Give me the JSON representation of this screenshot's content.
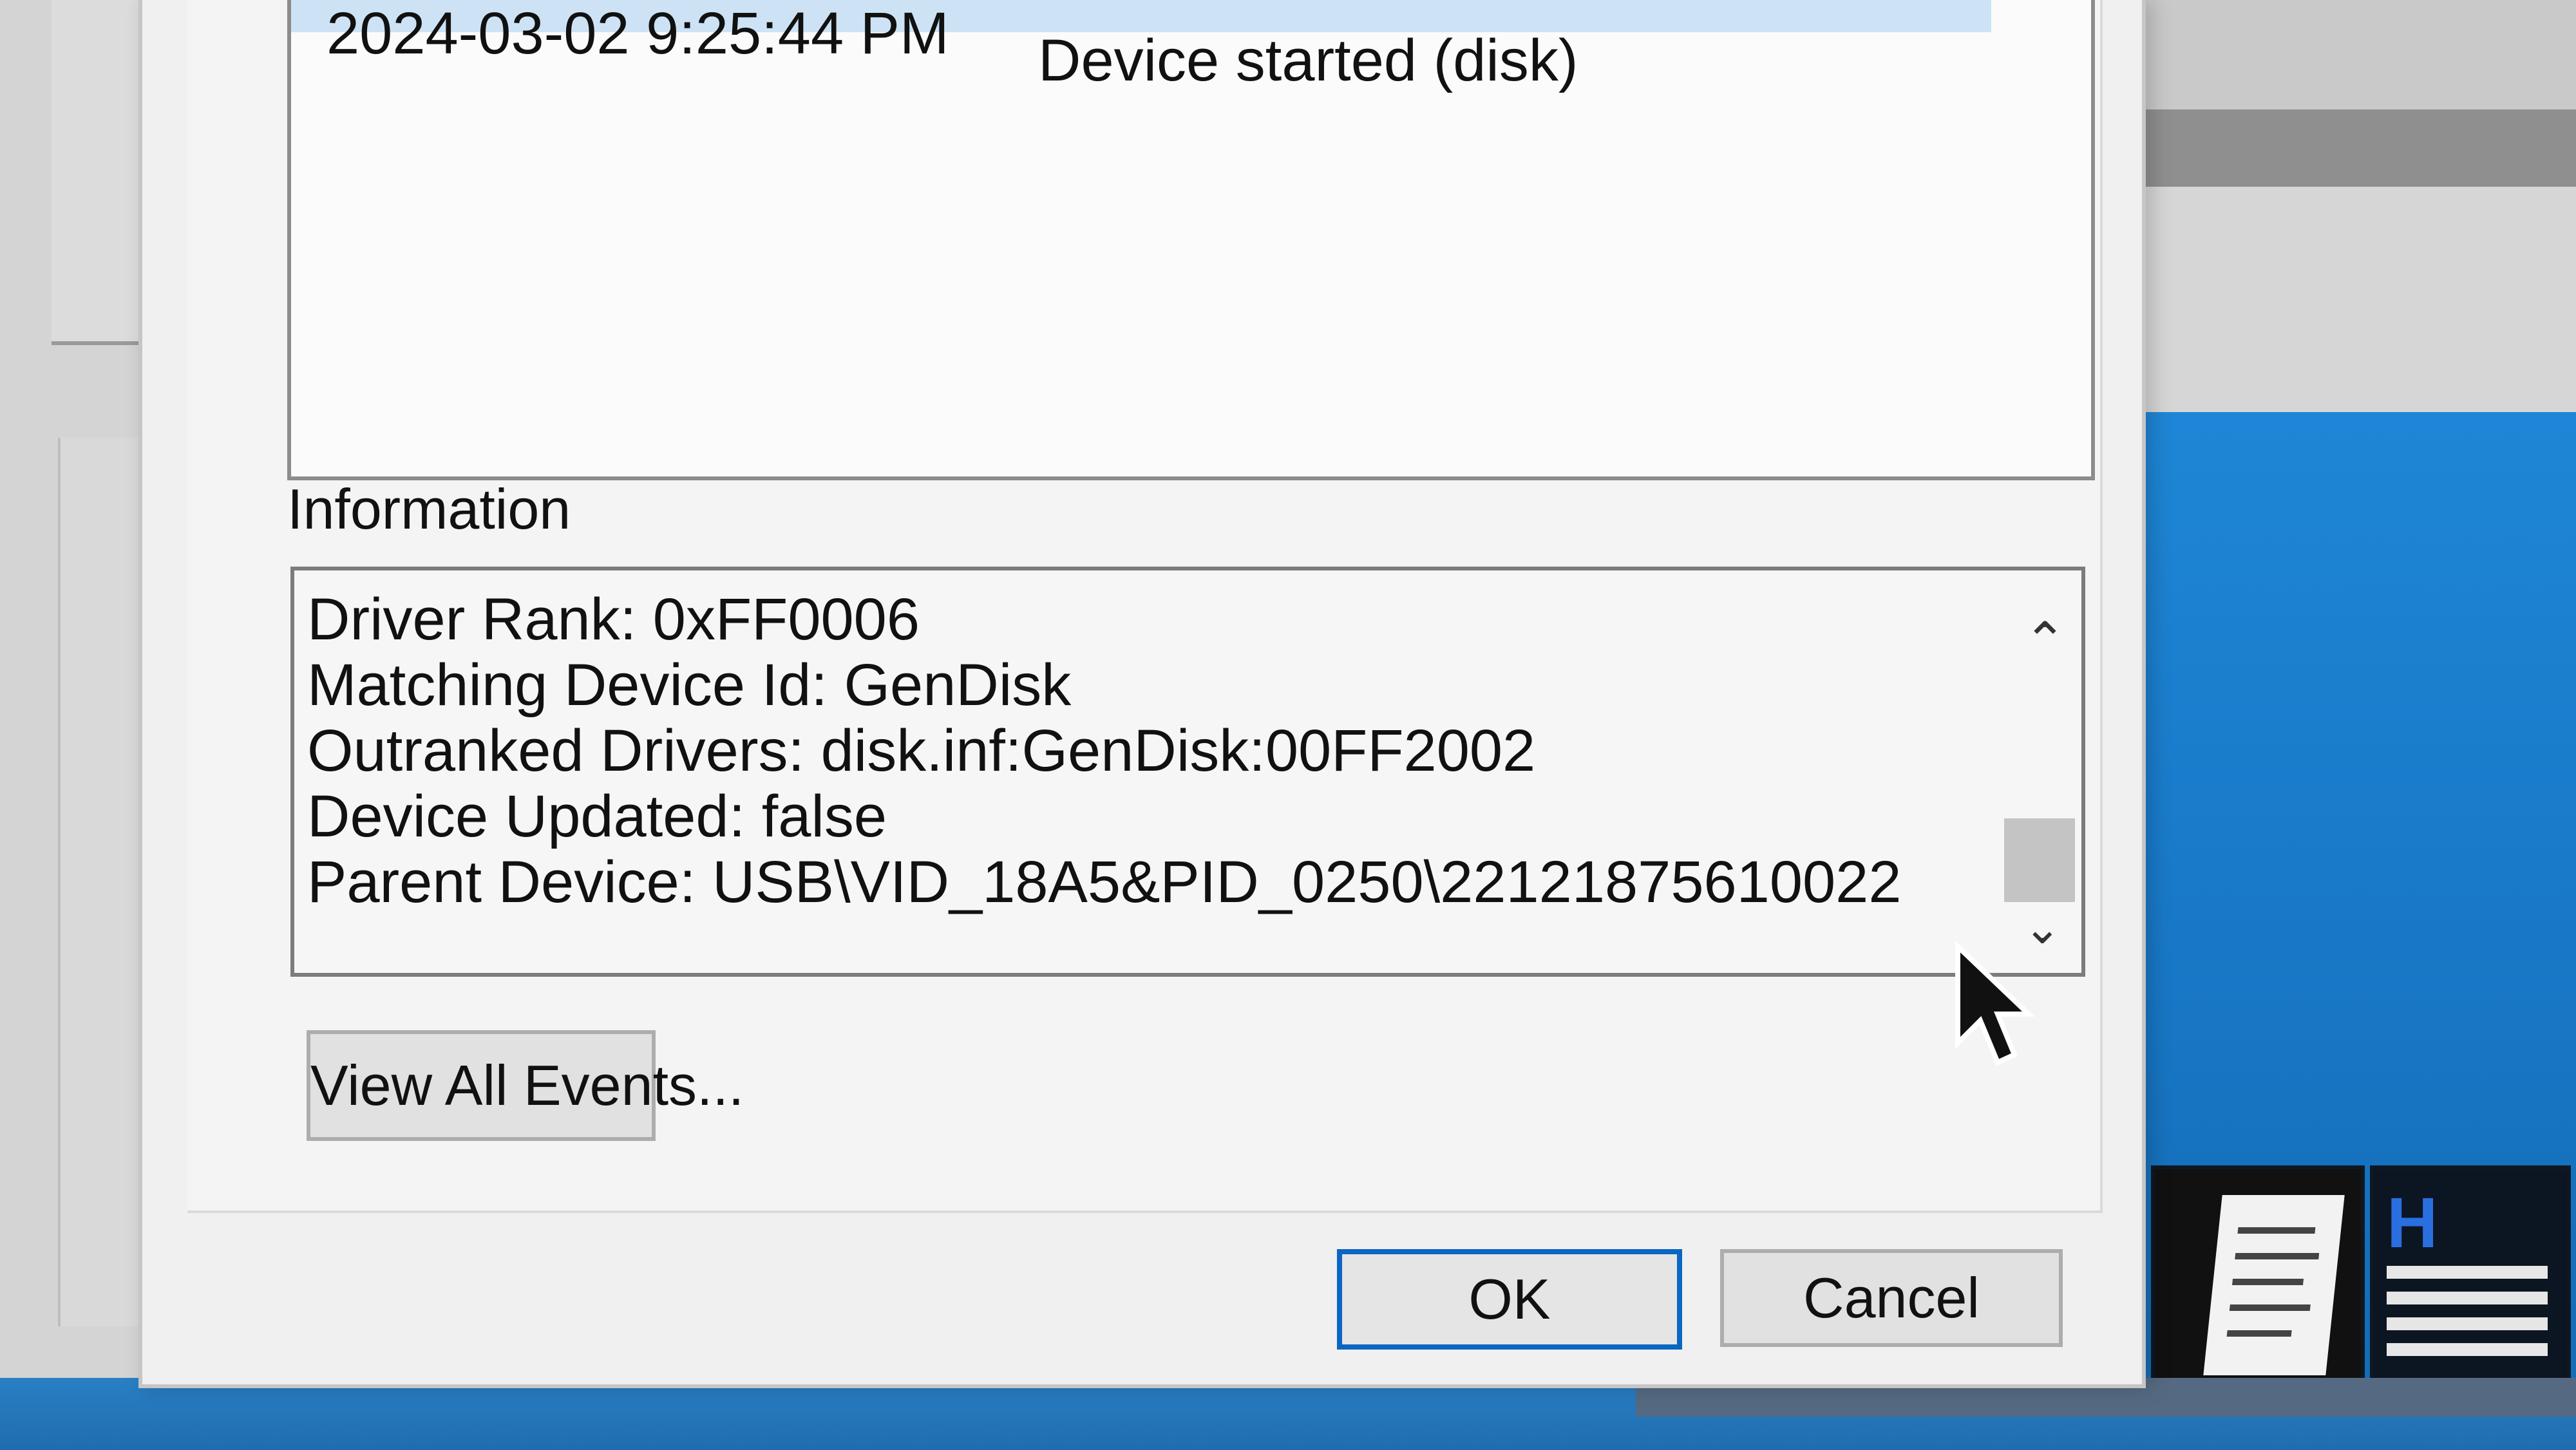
{
  "events": {
    "selected_row_date": "2024-03-02 9:25:44 PM",
    "selected_row_description": "Device started (disk)"
  },
  "information": {
    "label": "Information",
    "lines": [
      "Driver Rank: 0xFF0006",
      "Matching Device Id: GenDisk",
      "Outranked Drivers: disk.inf:GenDisk:00FF2002",
      "Device Updated: false",
      "Parent Device: USB\\VID_18A5&PID_0250\\22121875610022"
    ]
  },
  "buttons": {
    "view_all_events": "View All Events...",
    "ok": "OK",
    "cancel": "Cancel"
  },
  "icons": {
    "scroll_up": "chevron-up-icon",
    "scroll_down": "chevron-down-icon",
    "cursor": "mouse-pointer-icon",
    "desktop_printer": "printer-icon",
    "desktop_app": "h-grid-app-icon"
  },
  "colors": {
    "focus_border": "#0a66c2",
    "desktop_blue": "#1e86d6",
    "selected_row": "#cde3f5"
  }
}
